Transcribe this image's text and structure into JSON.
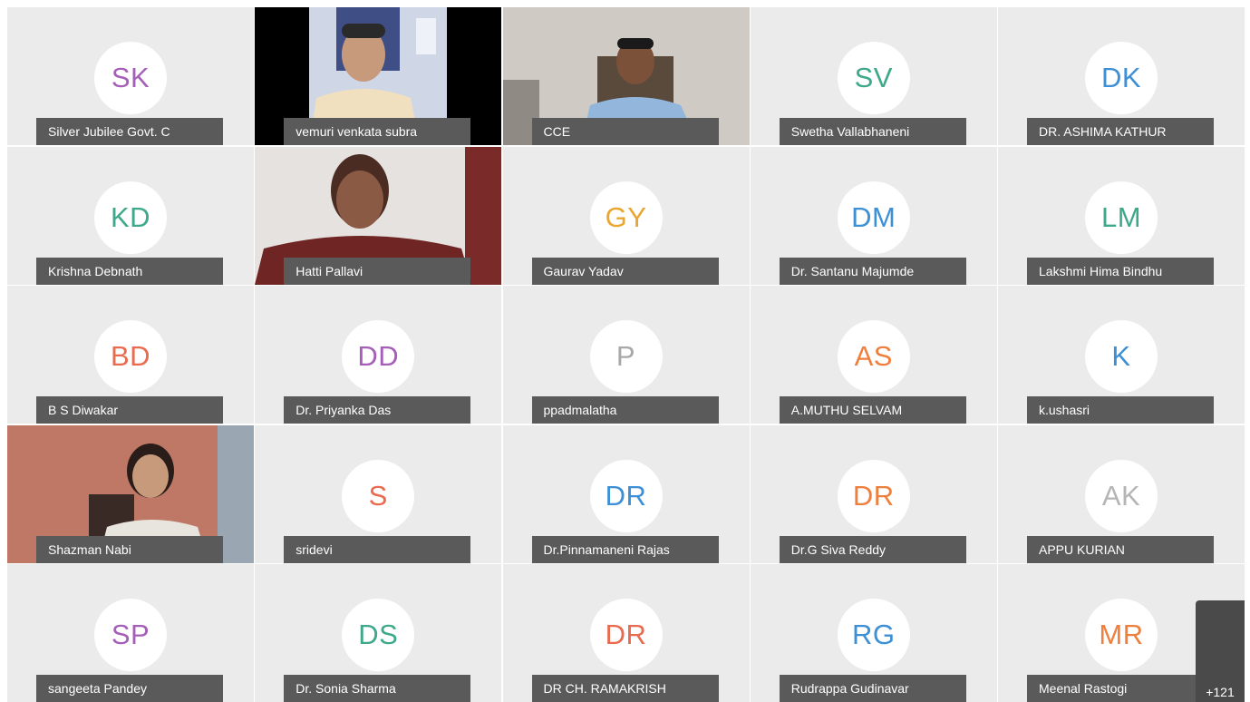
{
  "tiles": [
    {
      "name": "Silver Jubilee Govt. C",
      "initials": "SK",
      "color": "#a55fb8",
      "type": "avatar"
    },
    {
      "name": "vemuri venkata subra",
      "initials": "",
      "color": "",
      "type": "video"
    },
    {
      "name": "CCE",
      "initials": "",
      "color": "",
      "type": "video"
    },
    {
      "name": "Swetha Vallabhaneni",
      "initials": "SV",
      "color": "#3ea88a",
      "type": "avatar"
    },
    {
      "name": "DR. ASHIMA KATHUR",
      "initials": "DK",
      "color": "#3d8fd6",
      "type": "avatar"
    },
    {
      "name": "Krishna Debnath",
      "initials": "KD",
      "color": "#3ea88a",
      "type": "avatar"
    },
    {
      "name": "Hatti Pallavi",
      "initials": "",
      "color": "",
      "type": "video"
    },
    {
      "name": "Gaurav Yadav",
      "initials": "GY",
      "color": "#e9a630",
      "type": "avatar"
    },
    {
      "name": "Dr. Santanu Majumde",
      "initials": "DM",
      "color": "#3d8fd6",
      "type": "avatar"
    },
    {
      "name": "Lakshmi Hima Bindhu",
      "initials": "LM",
      "color": "#3ea88a",
      "type": "avatar"
    },
    {
      "name": "B S Diwakar",
      "initials": "BD",
      "color": "#e96a4e",
      "type": "avatar"
    },
    {
      "name": "Dr. Priyanka Das",
      "initials": "DD",
      "color": "#a55fb8",
      "type": "avatar"
    },
    {
      "name": "ppadmalatha",
      "initials": "P",
      "color": "#a8a8a8",
      "type": "avatar"
    },
    {
      "name": "A.MUTHU SELVAM",
      "initials": "AS",
      "color": "#ee7f3c",
      "type": "avatar"
    },
    {
      "name": "k.ushasri",
      "initials": "K",
      "color": "#3d8fd6",
      "type": "avatar"
    },
    {
      "name": "Shazman Nabi",
      "initials": "",
      "color": "",
      "type": "video"
    },
    {
      "name": "sridevi",
      "initials": "S",
      "color": "#e96a4e",
      "type": "avatar"
    },
    {
      "name": "Dr.Pinnamaneni Rajas",
      "initials": "DR",
      "color": "#3d8fd6",
      "type": "avatar"
    },
    {
      "name": "Dr.G Siva Reddy",
      "initials": "DR",
      "color": "#ee7f3c",
      "type": "avatar"
    },
    {
      "name": "APPU KURIAN",
      "initials": "AK",
      "color": "#b5b5b5",
      "type": "avatar"
    },
    {
      "name": "sangeeta Pandey",
      "initials": "SP",
      "color": "#a55fb8",
      "type": "avatar"
    },
    {
      "name": "Dr. Sonia Sharma",
      "initials": "DS",
      "color": "#3ea88a",
      "type": "avatar"
    },
    {
      "name": "DR CH. RAMAKRISH",
      "initials": "DR",
      "color": "#e96a4e",
      "type": "avatar"
    },
    {
      "name": "Rudrappa Gudinavar",
      "initials": "RG",
      "color": "#3d8fd6",
      "type": "avatar"
    },
    {
      "name": "Meenal Rastogi",
      "initials": "MR",
      "color": "#ee7f3c",
      "type": "avatar"
    }
  ],
  "more_participants": "+121"
}
